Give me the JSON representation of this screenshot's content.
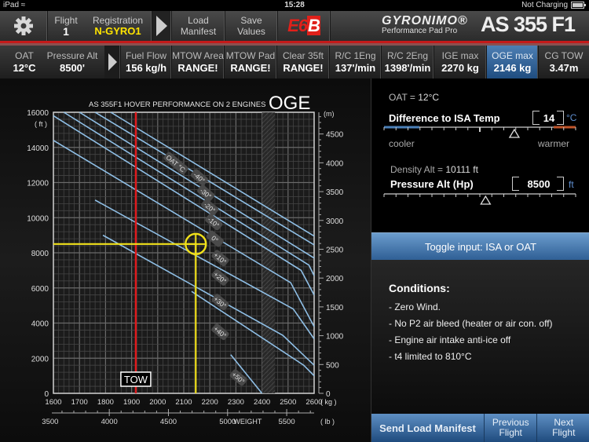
{
  "status_bar": {
    "device": "iPad",
    "time": "15:28",
    "battery_text": "Not Charging"
  },
  "toolbar": {
    "flight_label": "Flight",
    "flight_value": "1",
    "registration_label": "Registration",
    "registration_value": "N-GYRO1",
    "load_manifest_line1": "Load",
    "load_manifest_line2": "Manifest",
    "save_values_line1": "Save",
    "save_values_line2": "Values",
    "e6b_label_a": "E6",
    "e6b_label_b": "B",
    "brand_name": "GYRONIMO®",
    "brand_subtitle": "Performance Pad Pro",
    "aircraft_model": "AS 355 F1"
  },
  "info_bar": {
    "items": [
      {
        "label": "OAT",
        "value": "12°C"
      },
      {
        "label": "Pressure Alt",
        "value": "8500'"
      },
      {
        "label": "Fuel Flow",
        "value": "156 kg/h"
      },
      {
        "label": "MTOW Area",
        "value": "RANGE!"
      },
      {
        "label": "MTOW Pad",
        "value": "RANGE!"
      },
      {
        "label": "Clear 35ft",
        "value": "RANGE!"
      },
      {
        "label": "R/C 1Eng",
        "value": "137'/min"
      },
      {
        "label": "R/C 2Eng",
        "value": "1398'/min"
      },
      {
        "label": "IGE max",
        "value": "2270 kg"
      },
      {
        "label": "OGE max",
        "value": "2146 kg",
        "active": true
      },
      {
        "label": "CG TOW",
        "value": "3.47m"
      }
    ]
  },
  "chart_data": {
    "type": "line",
    "title": "AS 355F1 HOVER PERFORMANCE ON 2 ENGINES",
    "mode_label": "OGE",
    "xlabel": "WEIGHT",
    "x_unit": "( kg )",
    "x_secondary_unit": "( lb )",
    "y_unit": "( ft )",
    "y_secondary_unit": "(m)",
    "xlim": [
      1600,
      2600
    ],
    "ylim": [
      0,
      16000
    ],
    "x_ticks": [
      1600,
      1700,
      1800,
      1900,
      2000,
      2100,
      2200,
      2300,
      2400,
      2500,
      2600
    ],
    "y_ticks": [
      0,
      2000,
      4000,
      6000,
      8000,
      10000,
      12000,
      14000,
      16000
    ],
    "x_secondary_ticks": [
      "3500",
      "4000",
      "4500",
      "5000",
      "5500"
    ],
    "y_secondary_ticks": [
      "0",
      "500",
      "1000",
      "1500",
      "2000",
      "2500",
      "3000",
      "3500",
      "4000",
      "4500"
    ],
    "grid": true,
    "legend_title": "OAT °C",
    "series": [
      {
        "name": "-40°",
        "points": [
          [
            1820,
            16000
          ],
          [
            2600,
            8950
          ]
        ]
      },
      {
        "name": "-30°",
        "points": [
          [
            1760,
            16000
          ],
          [
            2600,
            8450
          ]
        ]
      },
      {
        "name": "-20°",
        "points": [
          [
            1700,
            16000
          ],
          [
            2600,
            7700
          ]
        ]
      },
      {
        "name": "-10°",
        "points": [
          [
            1640,
            16000
          ],
          [
            2580,
            7300
          ],
          [
            2600,
            6700
          ]
        ]
      },
      {
        "name": "0°",
        "points": [
          [
            1600,
            15800
          ],
          [
            2550,
            7000
          ],
          [
            2600,
            5600
          ]
        ]
      },
      {
        "name": "+10°",
        "points": [
          [
            1600,
            14400
          ],
          [
            2510,
            6300
          ],
          [
            2600,
            3800
          ]
        ]
      },
      {
        "name": "+20°",
        "points": [
          [
            1760,
            11000
          ],
          [
            2520,
            4800
          ],
          [
            2600,
            3100
          ]
        ]
      },
      {
        "name": "+30°",
        "points": [
          [
            1790,
            9000
          ],
          [
            2480,
            3300
          ],
          [
            2600,
            1600
          ]
        ]
      },
      {
        "name": "+40°",
        "points": [
          [
            2130,
            5800
          ],
          [
            2560,
            1600
          ],
          [
            2600,
            1000
          ]
        ]
      },
      {
        "name": "+50°",
        "points": [
          [
            2280,
            2200
          ],
          [
            2400,
            0
          ]
        ]
      }
    ],
    "annotations": {
      "tow_label": "TOW",
      "tow_weight_kg": 1916,
      "result_weight_kg": 2146,
      "pressure_alt_ft": 8500,
      "restricted_band_kg": [
        2400,
        2450
      ]
    }
  },
  "isa_panel": {
    "oat_label": "OAT =",
    "oat_value": "12°C",
    "diff_label": "Difference to ISA Temp",
    "diff_value": "14",
    "diff_unit": "°C",
    "cooler_label": "cooler",
    "warmer_label": "warmer",
    "diff_slider_fraction": 0.68,
    "density_alt_label": "Density Alt =",
    "density_alt_value": "10111 ft",
    "press_alt_label": "Pressure Alt (Hp)",
    "press_alt_value": "8500",
    "press_alt_unit": "ft",
    "press_alt_slider_fraction": 0.53,
    "toggle_label": "Toggle input: ISA or OAT"
  },
  "conditions": {
    "title": "Conditions:",
    "items": [
      "- Zero Wind.",
      "- No P2 air bleed (heater or air con. off)",
      "- Engine air intake anti-ice off",
      "- t4 limited to 810°C"
    ]
  },
  "bottom_buttons": {
    "send": "Send Load Manifest",
    "prev_line1": "Previous",
    "prev_line2": "Flight",
    "next_line1": "Next",
    "next_line2": "Flight"
  }
}
